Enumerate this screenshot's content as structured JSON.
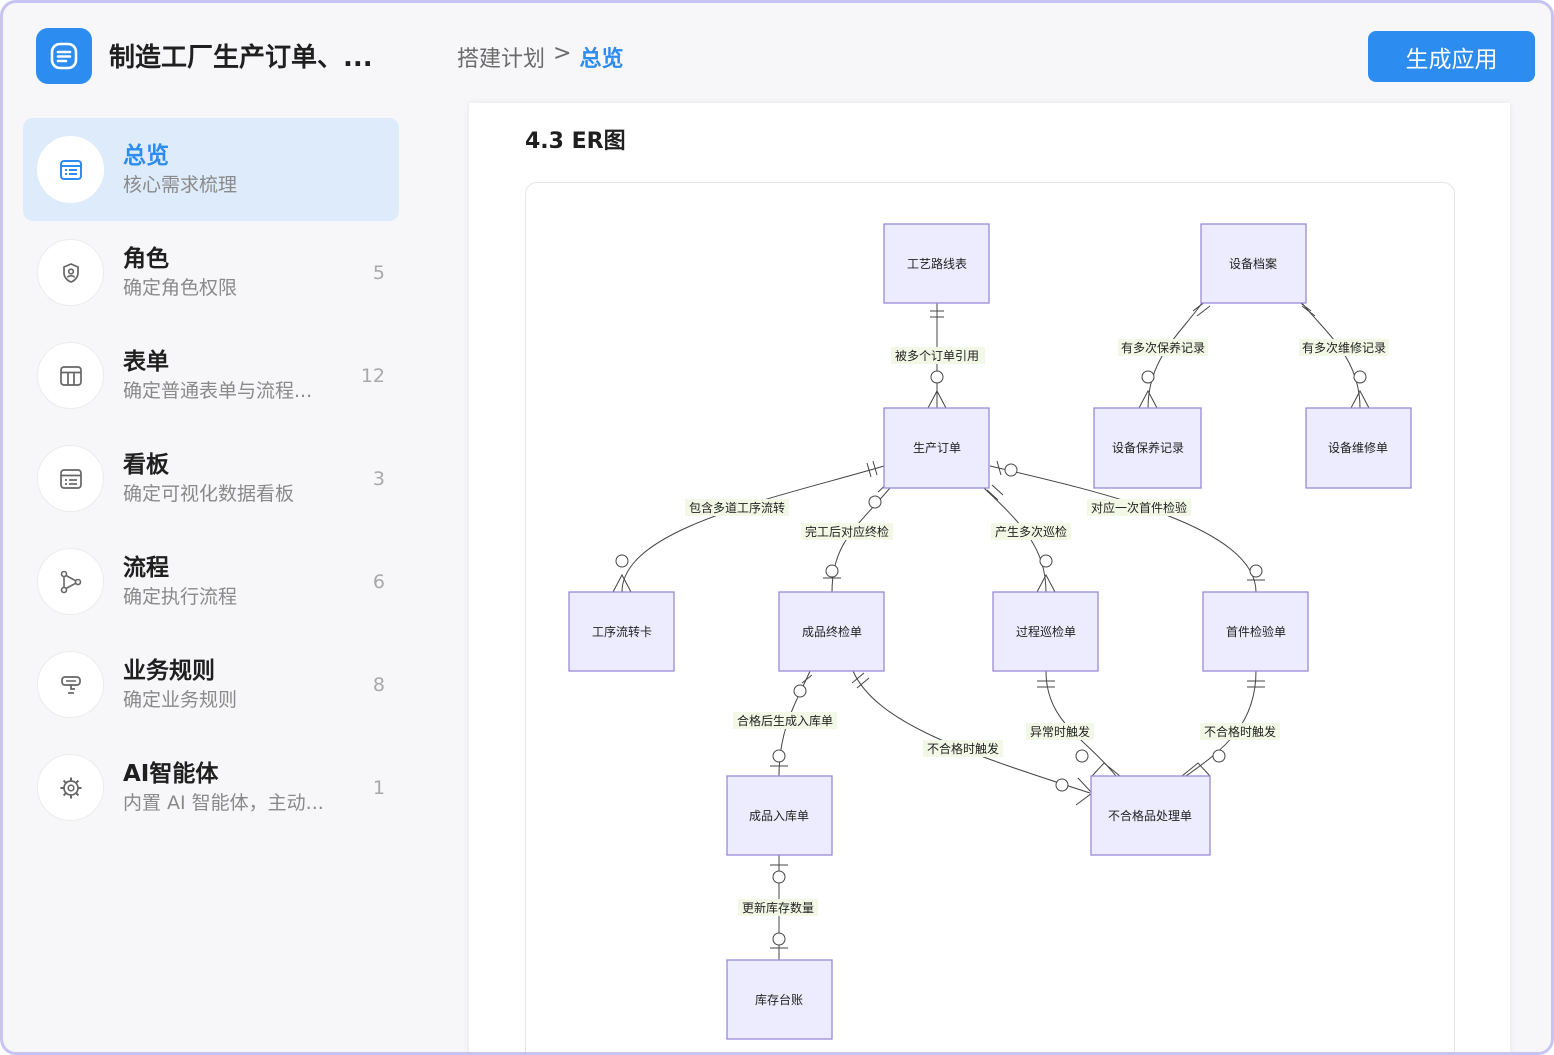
{
  "header": {
    "app_title": "制造工厂生产订单、...",
    "breadcrumb_parent": "搭建计划",
    "breadcrumb_sep": ">",
    "breadcrumb_current": "总览",
    "generate_label": "生成应用"
  },
  "sidebar": {
    "items": [
      {
        "title": "总览",
        "sub": "核心需求梳理",
        "count": "",
        "icon": "overview-icon",
        "active": true
      },
      {
        "title": "角色",
        "sub": "确定角色权限",
        "count": "5",
        "icon": "shield-user-icon"
      },
      {
        "title": "表单",
        "sub": "确定普通表单与流程...",
        "count": "12",
        "icon": "table-icon"
      },
      {
        "title": "看板",
        "sub": "确定可视化数据看板",
        "count": "3",
        "icon": "dashboard-icon"
      },
      {
        "title": "流程",
        "sub": "确定执行流程",
        "count": "6",
        "icon": "flow-icon"
      },
      {
        "title": "业务规则",
        "sub": "确定业务规则",
        "count": "8",
        "icon": "rule-icon"
      },
      {
        "title": "AI智能体",
        "sub": "内置 AI 智能体，主动...",
        "count": "1",
        "icon": "gear-icon"
      }
    ]
  },
  "main": {
    "section_title": "4.3 ER图"
  },
  "er": {
    "entities": [
      {
        "id": "process_route",
        "label": "工艺路线表"
      },
      {
        "id": "equipment",
        "label": "设备档案"
      },
      {
        "id": "order",
        "label": "生产订单"
      },
      {
        "id": "maint_record",
        "label": "设备保养记录"
      },
      {
        "id": "repair",
        "label": "设备维修单"
      },
      {
        "id": "flow_card",
        "label": "工序流转卡"
      },
      {
        "id": "final_insp",
        "label": "成品终检单"
      },
      {
        "id": "patrol_insp",
        "label": "过程巡检单"
      },
      {
        "id": "first_insp",
        "label": "首件检验单"
      },
      {
        "id": "stock_in",
        "label": "成品入库单"
      },
      {
        "id": "nonconform",
        "label": "不合格品处理单"
      },
      {
        "id": "ledger",
        "label": "库存台账"
      }
    ],
    "relations": [
      {
        "id": "r1",
        "label": "被多个订单引用"
      },
      {
        "id": "r2",
        "label": "有多次保养记录"
      },
      {
        "id": "r3",
        "label": "有多次维修记录"
      },
      {
        "id": "r4",
        "label": "包含多道工序流转"
      },
      {
        "id": "r5",
        "label": "完工后对应终检"
      },
      {
        "id": "r6",
        "label": "产生多次巡检"
      },
      {
        "id": "r7",
        "label": "对应一次首件检验"
      },
      {
        "id": "r8",
        "label": "合格后生成入库单"
      },
      {
        "id": "r9",
        "label": "不合格时触发"
      },
      {
        "id": "r10",
        "label": "异常时触发"
      },
      {
        "id": "r11",
        "label": "不合格时触发"
      },
      {
        "id": "r12",
        "label": "更新库存数量"
      }
    ]
  }
}
